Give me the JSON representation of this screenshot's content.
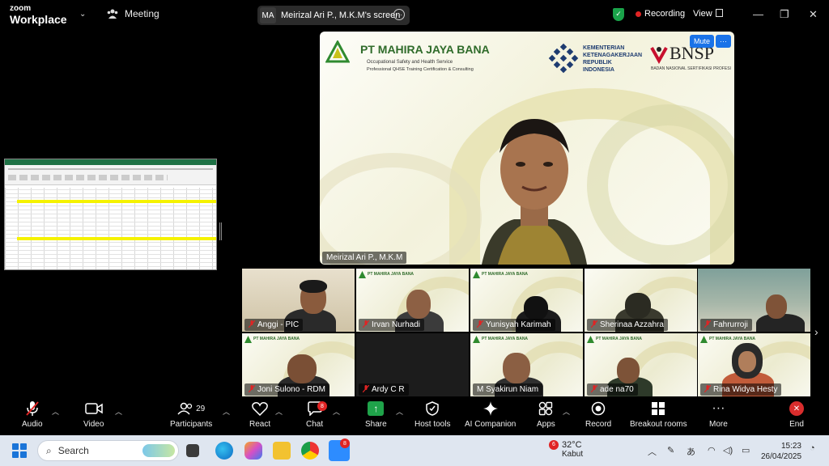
{
  "topbar": {
    "logo_line1": "zoom",
    "logo_line2": "Workplace",
    "meeting_label": "Meeting",
    "sharer_initials": "MA",
    "sharer_label": "Meirizal Ari P., M.K.M's screen",
    "more_icon": "more-horizontal-icon",
    "recording_label": "Recording",
    "view_label": "View",
    "colors": {
      "shield": "#1aa34a",
      "record_dot": "#e02424"
    }
  },
  "presentation": {
    "company": "PT MAHIRA JAYA BANA",
    "company_sub1": "Occupational Safety and Health Service",
    "company_sub2": "Professional QHSE Training Certification & Consulting",
    "ministry_lines": [
      "KEMENTERIAN",
      "KETENAGAKERJAAN",
      "REPUBLIK",
      "INDONESIA"
    ],
    "bnsp": "BNSP",
    "bnsp_sub": "BADAN NASIONAL SERTIFIKASI PROFESI",
    "speaker_name": "Meirizal Ari P., M.K.M",
    "mute_label": "Mute",
    "more_label": "···"
  },
  "participants_strip": [
    {
      "name": "Anggi - PIC",
      "muted": true
    },
    {
      "name": "Irvan Nurhadi",
      "muted": true
    },
    {
      "name": "Yunisyah Karimah",
      "muted": true
    },
    {
      "name": "Sherinaa Azzahra",
      "muted": true
    },
    {
      "name": "Fahrurroji",
      "muted": true
    },
    {
      "name": "Joni Sulono - RDM",
      "muted": true
    },
    {
      "name": "Ardy C R",
      "muted": true
    },
    {
      "name": "M Syakirun Niam",
      "muted": false
    },
    {
      "name": "ade na70",
      "muted": true
    },
    {
      "name": "Rina Widya Hesty",
      "muted": true
    }
  ],
  "toolbar": {
    "audio": "Audio",
    "video": "Video",
    "participants": "Participants",
    "participants_count": "29",
    "react": "React",
    "chat": "Chat",
    "chat_badge": "8",
    "share": "Share",
    "host_tools": "Host tools",
    "ai_companion": "AI Companion",
    "apps": "Apps",
    "record": "Record",
    "breakout": "Breakout rooms",
    "more": "More",
    "end": "End"
  },
  "taskbar": {
    "search_placeholder": "Search",
    "zoom_badge": "8",
    "weather_badge": "6",
    "temperature": "32°C",
    "weather_desc": "Kabut",
    "time": "15:23",
    "date": "26/04/2025"
  }
}
